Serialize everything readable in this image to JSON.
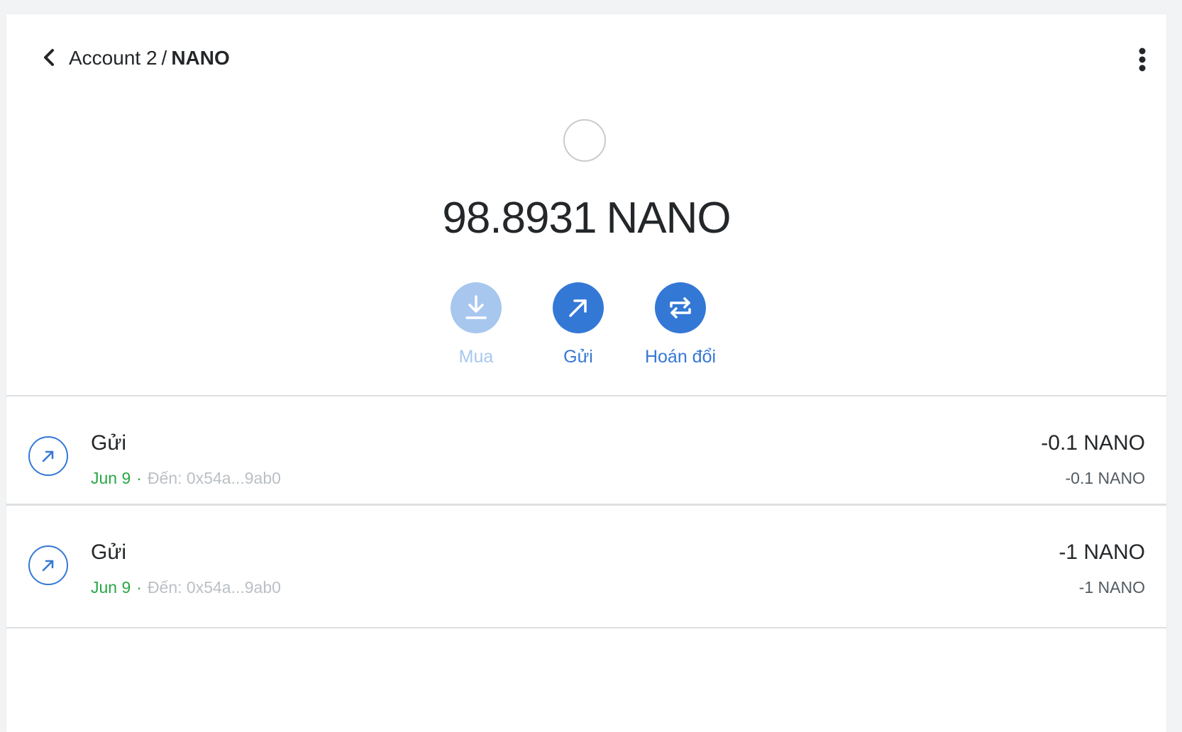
{
  "header": {
    "account": "Account 2",
    "separator": "/",
    "token": "NANO"
  },
  "overview": {
    "balance_value": "98.8931",
    "balance_unit": "NANO"
  },
  "actions": {
    "buy_label": "Mua",
    "send_label": "Gửi",
    "swap_label": "Hoán đổi"
  },
  "transactions": [
    {
      "title": "Gửi",
      "date": "Jun 9",
      "dot": "·",
      "to": "Đến: 0x54a...9ab0",
      "amount": "-0.1 NANO",
      "amount_secondary": "-0.1 NANO"
    },
    {
      "title": "Gửi",
      "date": "Jun 9",
      "dot": "·",
      "to": "Đến: 0x54a...9ab0",
      "amount": "-1 NANO",
      "amount_secondary": "-1 NANO"
    }
  ],
  "colors": {
    "primary": "#3478d6",
    "primary_disabled": "#a8c7ef",
    "success": "#28a745",
    "muted": "#bbc0c5",
    "text": "#24272a"
  },
  "icons": {
    "back": "chevron-left-icon",
    "menu": "kebab-menu-icon",
    "buy": "download-icon",
    "send": "arrow-up-right-icon",
    "swap": "swap-arrows-icon"
  }
}
